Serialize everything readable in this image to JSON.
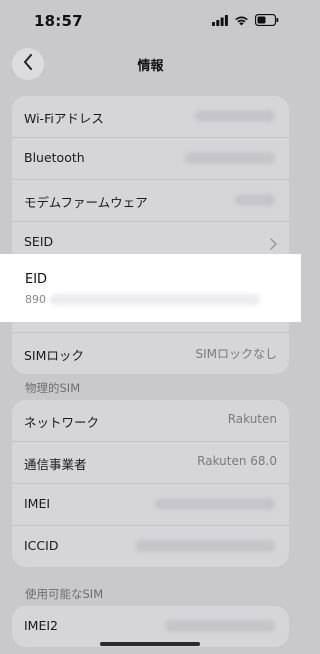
{
  "status": {
    "time": "18:57"
  },
  "header": {
    "title": "情報"
  },
  "group1": {
    "rows": [
      {
        "label": "Wi-Fiアドレス"
      },
      {
        "label": "Bluetooth"
      },
      {
        "label": "モデムファームウェア"
      },
      {
        "label": "SEID"
      },
      {
        "label": "EID",
        "value": "890"
      },
      {
        "label": "SIMロック",
        "value": "SIMロックなし"
      }
    ]
  },
  "section_physical": "物理的SIM",
  "group2": {
    "rows": [
      {
        "label": "ネットワーク",
        "value": "Rakuten"
      },
      {
        "label": "通信事業者",
        "value": "Rakuten 68.0"
      },
      {
        "label": "IMEI"
      },
      {
        "label": "ICCID"
      }
    ]
  },
  "section_available": "使用可能なSIM",
  "group3": {
    "rows": [
      {
        "label": "IMEI2"
      }
    ]
  },
  "colors": {
    "background": "#c9c9cc",
    "card": "#d6d6d9",
    "highlight": "#ffffff"
  }
}
